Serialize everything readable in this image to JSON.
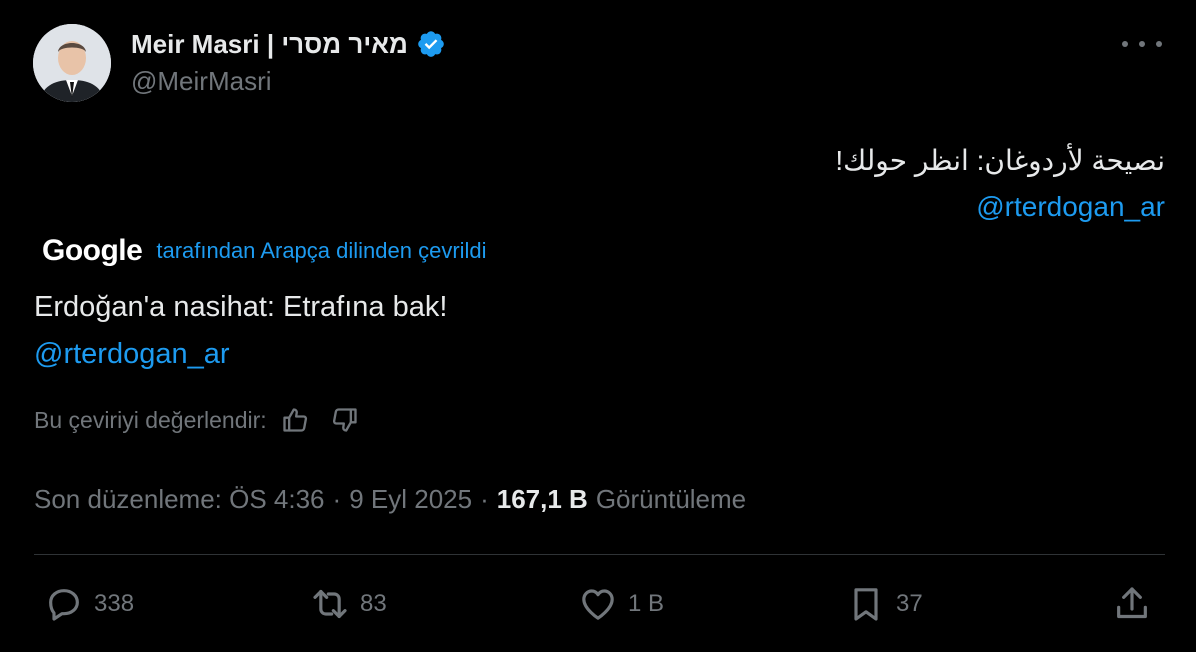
{
  "tweet": {
    "author": {
      "display_name": "Meir Masri | מאיר מסרי",
      "handle": "@MeirMasri",
      "verified": true
    },
    "original_text": "نصيحة لأردوغان: انظر حولك!",
    "original_mention": "@rterdogan_ar",
    "translation": {
      "provider": "Google",
      "label": "tarafından Arapça dilinden çevrildi",
      "text": "Erdoğan'a nasihat: Etrafına bak!",
      "mention": "@rterdogan_ar",
      "rate_label": "Bu çeviriyi değerlendir:"
    },
    "meta": {
      "edited_label": "Son düzenleme: ÖS 4:36",
      "sep": "·",
      "date": "9 Eyl 2025",
      "views": "167,1 B",
      "views_label": "Görüntüleme"
    },
    "actions": {
      "replies": "338",
      "reposts": "83",
      "likes": "1 B",
      "bookmarks": "37"
    }
  },
  "colors": {
    "background": "#000000",
    "text": "#e7e9ea",
    "muted": "#71767b",
    "accent": "#1d9bf0",
    "divider": "#2f3336"
  }
}
